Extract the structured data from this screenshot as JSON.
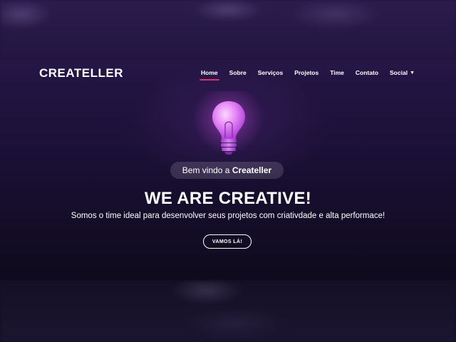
{
  "brand": "CREATELLER",
  "nav": {
    "items": [
      {
        "label": "Home",
        "active": true
      },
      {
        "label": "Sobre"
      },
      {
        "label": "Serviços"
      },
      {
        "label": "Projetos"
      },
      {
        "label": "Time"
      },
      {
        "label": "Contato"
      },
      {
        "label": "Social"
      }
    ]
  },
  "hero": {
    "pill_prefix": "Bem vindo a ",
    "pill_brand": "Createller",
    "headline": "WE ARE CREATIVE!",
    "subtitle": "Somos o time ideal para desenvolver seus projetos com criativdade e alta performace!",
    "cta": "VAMOS LÁ!"
  },
  "icons": [
    "lightbulb-icon",
    "chevron-down-icon"
  ],
  "colors": {
    "accent": "#e0326a",
    "bulb": "#d96cf0",
    "background": "#1d1334"
  }
}
